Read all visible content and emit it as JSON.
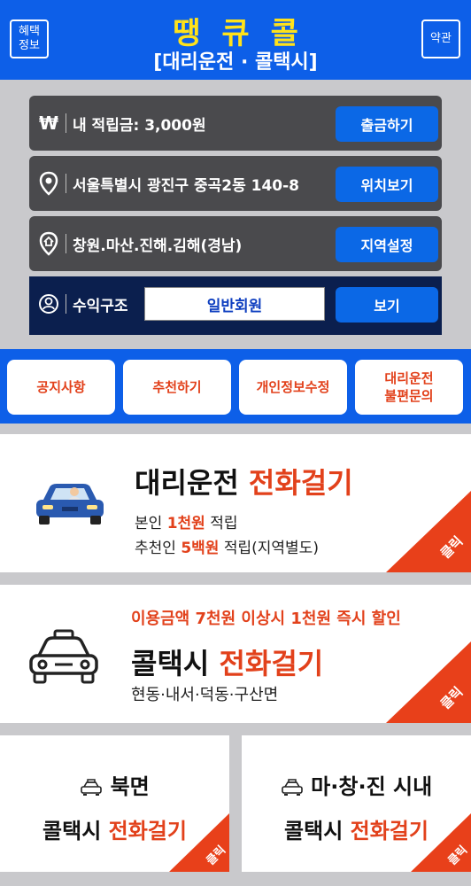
{
  "header": {
    "left_button_label": "혜택\n정보",
    "right_button_label": "약관",
    "title": "땡큐콜",
    "subtitle": "[대리운전 · 콜택시]"
  },
  "rows": [
    {
      "icon": "won-icon",
      "text": "내 적립금: 3,000원",
      "button": "출금하기"
    },
    {
      "icon": "location-pin-icon",
      "text": "서울특별시 광진구 중곡2동 140-8",
      "button": "위치보기"
    },
    {
      "icon": "home-pin-icon",
      "text": "창원.마산.진해.김해(경남)",
      "button": "지역설정"
    },
    {
      "icon": "profit-icon",
      "text": "수익구조",
      "member": "일반회원",
      "button": "보기"
    }
  ],
  "menu": [
    "공지사항",
    "추천하기",
    "개인정보수정",
    "대리운전\n불편문의"
  ],
  "cards": {
    "designated_driver": {
      "title_main": "대리운전 ",
      "title_red": "전화걸기",
      "line1_a": "본인 ",
      "line1_red": "1천원",
      "line1_b": " 적립",
      "line2_a": "추천인 ",
      "line2_red": "5백원",
      "line2_b": " 적립(지역별도)",
      "corner": "클릭"
    },
    "call_taxi": {
      "promo": "이용금액 7천원 이상시 1천원 즉시 할인",
      "title_main": "콜택시 ",
      "title_red": "전화걸기",
      "areas": "현동·내서·덕동·구산면",
      "corner": "클릭"
    },
    "north": {
      "area": "북면",
      "title_main": "콜택시 ",
      "title_red": "전화걸기",
      "corner": "클릭"
    },
    "city": {
      "area": "마·창·진 시내",
      "title_main": "콜택시 ",
      "title_red": "전화걸기",
      "corner": "클릭"
    }
  },
  "colors": {
    "brand_blue": "#0d5fe8",
    "accent_red": "#e2411b",
    "title_yellow": "#ffe21a"
  }
}
